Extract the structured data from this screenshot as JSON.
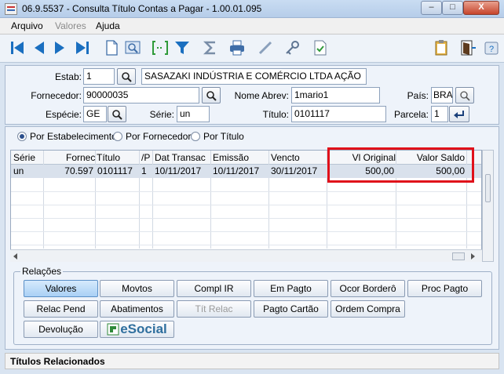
{
  "window": {
    "title": "06.9.5537 - Consulta Título Contas a Pagar - 1.00.01.095",
    "controls": [
      "–",
      "□",
      "X"
    ]
  },
  "menu": {
    "items": [
      "Arquivo",
      "Valores",
      "Ajuda"
    ]
  },
  "form": {
    "estab_label": "Estab:",
    "estab_value": "1",
    "estab_name": "SASAZAKI INDÚSTRIA E COMÉRCIO LTDA AÇÃO",
    "fornecedor_label": "Fornecedor:",
    "fornecedor_value": "90000035",
    "nome_abrev_label": "Nome Abrev:",
    "nome_abrev_value": "1mario1",
    "pais_label": "País:",
    "pais_value": "BRA",
    "especie_label": "Espécie:",
    "especie_value": "GE",
    "serie_label": "Série:",
    "serie_value": "un",
    "titulo_label": "Título:",
    "titulo_value": "0101117",
    "parcela_label": "Parcela:",
    "parcela_value": "1"
  },
  "sort_options": {
    "items": [
      "Por Estabelecimento",
      "Por Fornecedor",
      "Por Título"
    ],
    "selected": "Por Estabelecimento"
  },
  "table": {
    "columns": [
      "Série",
      "Fornec",
      "Título",
      "/P",
      "Dat Transac",
      "Emissão",
      "Vencto",
      "Vl Original",
      "Valor Saldo"
    ],
    "rows": [
      [
        "un",
        "70.597",
        "0101117",
        "1",
        "10/11/2017",
        "10/11/2017",
        "30/11/2017",
        "500,00",
        "500,00"
      ]
    ]
  },
  "relacoes": {
    "title": "Relações",
    "row1": [
      "Valores",
      "Movtos",
      "Compl IR",
      "Em Pagto",
      "Ocor Borderô",
      "Proc Pagto"
    ],
    "row2": [
      "Relac Pend",
      "Abatimentos",
      "Tít Relac",
      "Pagto Cartão",
      "Ordem Compra"
    ],
    "row3": [
      "Devolução"
    ],
    "esocial_label": "eSocial"
  },
  "status": {
    "text": "Títulos Relacionados"
  },
  "colors": {
    "highlight": "#e0101a",
    "accent": "#1a6fc0"
  }
}
